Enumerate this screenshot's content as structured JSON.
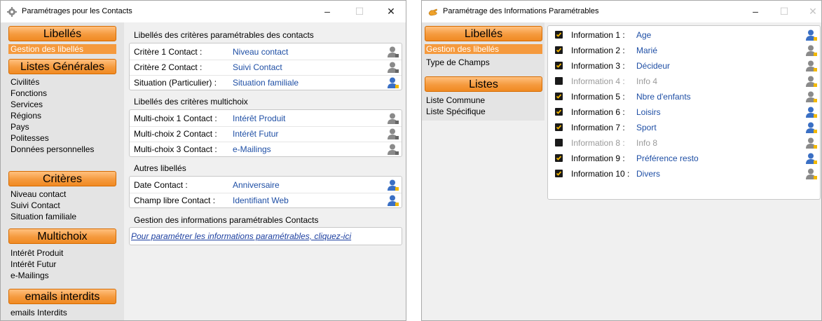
{
  "window1": {
    "title": "Paramétrages pour les Contacts",
    "controls": {
      "minimize": "–",
      "maximize": "☐",
      "close": "✕"
    },
    "sidebar": {
      "sections": [
        {
          "title": "Libellés",
          "items": [
            {
              "label": "Gestion des libellés",
              "selected": true
            }
          ]
        },
        {
          "title": "Listes Générales",
          "items": [
            {
              "label": "Civilités"
            },
            {
              "label": "Fonctions"
            },
            {
              "label": "Services"
            },
            {
              "label": "Régions"
            },
            {
              "label": "Pays"
            },
            {
              "label": "Politesses"
            },
            {
              "label": "Données personnelles"
            }
          ]
        },
        {
          "title": "Critères",
          "items": [
            {
              "label": "Niveau contact"
            },
            {
              "label": "Suivi Contact"
            },
            {
              "label": "Situation familiale"
            }
          ]
        },
        {
          "title": "Multichoix",
          "items": [
            {
              "label": "Intérêt Produit"
            },
            {
              "label": "Intérêt Futur"
            },
            {
              "label": "e-Mailings"
            }
          ]
        },
        {
          "title": "emails interdits",
          "items": [
            {
              "label": "emails Interdits"
            }
          ]
        }
      ]
    },
    "main": {
      "groups": [
        {
          "header": "Libellés des critères paramétrables des contacts",
          "rows": [
            {
              "label": "Critère 1 Contact :",
              "value": "Niveau contact",
              "icon": "user-gray"
            },
            {
              "label": "Critère 2 Contact :",
              "value": "Suivi Contact",
              "icon": "user-gray"
            },
            {
              "label": "Situation (Particulier) :",
              "value": "Situation familiale",
              "icon": "user-blue"
            }
          ]
        },
        {
          "header": "Libellés des critères multichoix",
          "rows": [
            {
              "label": "Multi-choix 1 Contact :",
              "value": "Intérêt Produit",
              "icon": "user-gray"
            },
            {
              "label": "Multi-choix 2 Contact :",
              "value": "Intérêt Futur",
              "icon": "user-gray"
            },
            {
              "label": "Multi-choix 3 Contact :",
              "value": "e-Mailings",
              "icon": "user-gray"
            }
          ]
        },
        {
          "header": "Autres libellés",
          "rows": [
            {
              "label": "Date Contact :",
              "value": "Anniversaire",
              "icon": "user-blue"
            },
            {
              "label": "Champ libre Contact :",
              "value": "Identifiant Web",
              "icon": "user-blue"
            }
          ]
        }
      ],
      "info_header": "Gestion des informations paramétrables Contacts",
      "info_link": "Pour paramétrer les informations paramétrables, cliquez-ici"
    }
  },
  "window2": {
    "title": "Paramétrage des Informations Paramétrables",
    "controls": {
      "minimize": "–",
      "maximize": "☐",
      "close": "✕"
    },
    "sidebar": {
      "sections": [
        {
          "title": "Libellés",
          "items": [
            {
              "label": "Gestion des libellés",
              "selected": true
            },
            {
              "label": "Type de Champs"
            }
          ]
        },
        {
          "title": "Listes",
          "items": [
            {
              "label": "Liste Commune"
            },
            {
              "label": "Liste Spécifique"
            }
          ]
        }
      ]
    },
    "informations": [
      {
        "label": "Information 1 :",
        "value": "Age",
        "checked": true
      },
      {
        "label": "Information 2 :",
        "value": "Marié",
        "checked": true
      },
      {
        "label": "Information 3 :",
        "value": "Décideur",
        "checked": true
      },
      {
        "label": "Information 4 :",
        "value": "Info 4",
        "checked": false
      },
      {
        "label": "Information 5 :",
        "value": "Nbre d'enfants",
        "checked": true
      },
      {
        "label": "Information 6 :",
        "value": "Loisirs",
        "checked": true
      },
      {
        "label": "Information 7 :",
        "value": "Sport",
        "checked": true
      },
      {
        "label": "Information 8 :",
        "value": "Info 8",
        "checked": false
      },
      {
        "label": "Information 9 :",
        "value": "Préférence resto",
        "checked": true
      },
      {
        "label": "Information 10 :",
        "value": "Divers",
        "checked": true
      }
    ]
  },
  "colors": {
    "accent_orange": "#f59a3e",
    "value_blue": "#1f4fa5",
    "link_blue": "#1c3fa0"
  }
}
